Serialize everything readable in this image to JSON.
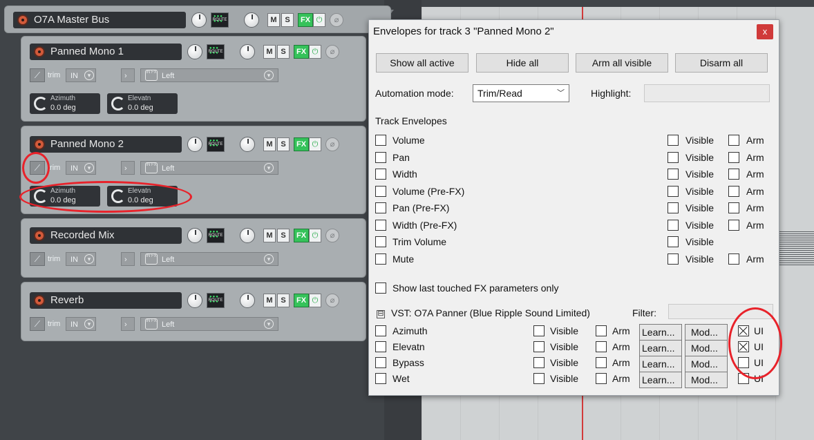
{
  "tracks": [
    {
      "name": "O7A Master Bus",
      "route": "ROUTE",
      "mute": "M",
      "solo": "S",
      "fx": "FX"
    },
    {
      "name": "Panned Mono 1",
      "route": "ROUTE",
      "mute": "M",
      "solo": "S",
      "fx": "FX",
      "trim": "trim",
      "input": "IN",
      "input_mode": "Left",
      "fxin": "IN FX",
      "params": [
        {
          "name": "Azimuth",
          "value": "0.0 deg"
        },
        {
          "name": "Elevatn",
          "value": "0.0 deg"
        }
      ]
    },
    {
      "name": "Panned Mono 2",
      "route": "ROUTE",
      "mute": "M",
      "solo": "S",
      "fx": "FX",
      "trim": "trim",
      "input": "IN",
      "input_mode": "Left",
      "fxin": "IN FX",
      "params": [
        {
          "name": "Azimuth",
          "value": "0.0 deg"
        },
        {
          "name": "Elevatn",
          "value": "0.0 deg"
        }
      ]
    },
    {
      "name": "Recorded Mix",
      "route": "ROUTE",
      "mute": "M",
      "solo": "S",
      "fx": "FX",
      "trim": "trim",
      "input": "IN",
      "input_mode": "Left",
      "fxin": "IN FX"
    },
    {
      "name": "Reverb",
      "route": "ROUTE",
      "mute": "M",
      "solo": "S",
      "fx": "FX",
      "trim": "trim",
      "input": "IN",
      "input_mode": "Left",
      "fxin": "IN FX"
    }
  ],
  "dialog": {
    "title": "Envelopes for track 3 \"Panned Mono 2\"",
    "close": "x",
    "buttons": [
      "Show all active",
      "Hide all",
      "Arm all visible",
      "Disarm all"
    ],
    "automation_mode_label": "Automation mode:",
    "automation_mode_value": "Trim/Read",
    "highlight_label": "Highlight:",
    "track_envelopes_header": "Track Envelopes",
    "visible_label": "Visible",
    "arm_label": "Arm",
    "track_envelopes": [
      {
        "name": "Volume",
        "arm": true
      },
      {
        "name": "Pan",
        "arm": true
      },
      {
        "name": "Width",
        "arm": true
      },
      {
        "name": "Volume (Pre-FX)",
        "arm": true
      },
      {
        "name": "Pan (Pre-FX)",
        "arm": true
      },
      {
        "name": "Width (Pre-FX)",
        "arm": true
      },
      {
        "name": "Trim Volume",
        "arm": false
      },
      {
        "name": "Mute",
        "arm": true
      }
    ],
    "show_last_touched": "Show last touched FX parameters only",
    "collapse_glyph": "⊟",
    "plugin_label": "VST: O7A Panner (Blue Ripple Sound Limited)",
    "filter_label": "Filter:",
    "learn_label": "Learn...",
    "mod_label": "Mod...",
    "ui_label": "UI",
    "fx_params": [
      {
        "name": "Azimuth",
        "ui": true
      },
      {
        "name": "Elevatn",
        "ui": true
      },
      {
        "name": "Bypass",
        "ui": false
      },
      {
        "name": "Wet",
        "ui": false
      }
    ]
  },
  "colors": {
    "annotation": "#e8222a",
    "fx_green": "#35c25a",
    "close_red": "#d03a3a"
  }
}
